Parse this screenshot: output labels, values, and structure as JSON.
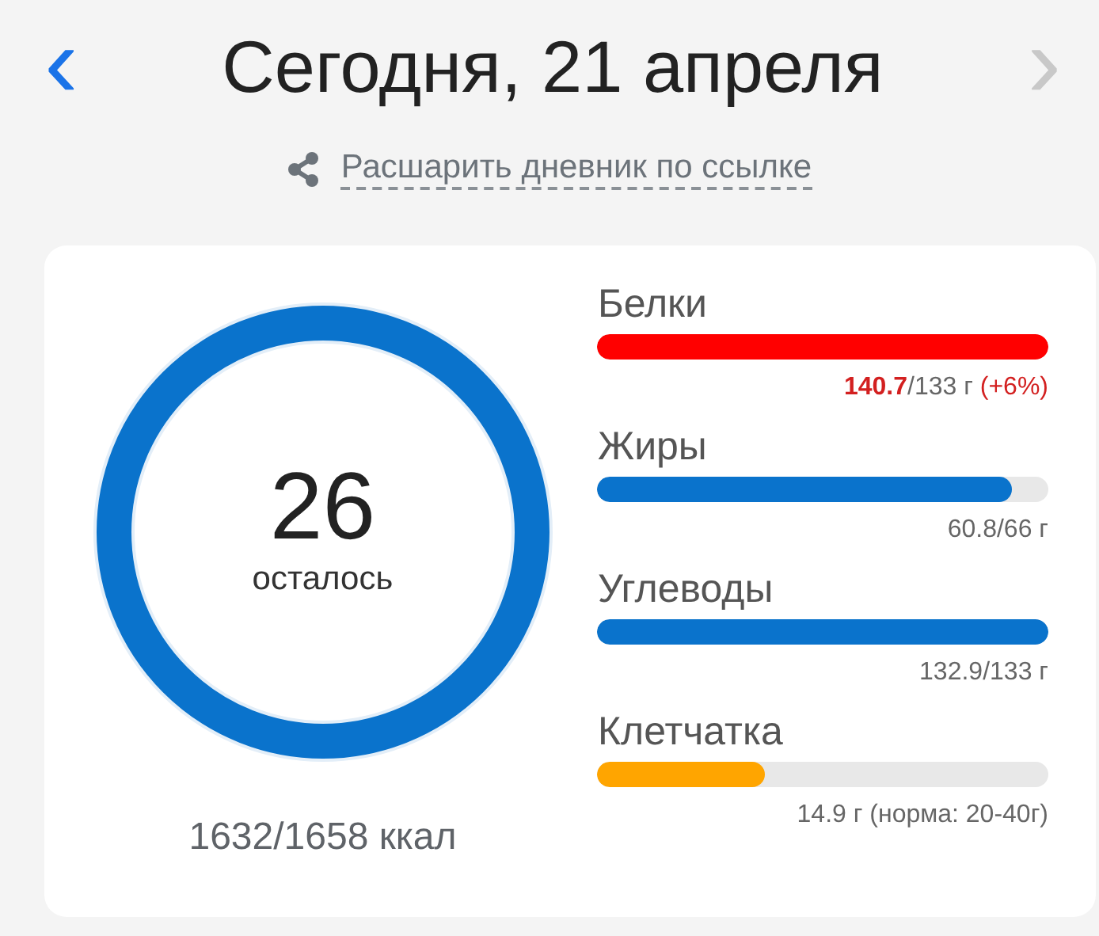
{
  "header": {
    "prev_arrow": "‹",
    "title": "Сегодня, 21 апреля",
    "next_arrow": "›",
    "share_link": "Расшарить дневник по ссылке"
  },
  "calories": {
    "level": 1,
    "remaining": "26",
    "remaining_label": "осталось",
    "total": "1632/1658 ккал"
  },
  "macros": [
    {
      "name": "Белки",
      "level": 1,
      "color": "#ff0000",
      "over": true,
      "value": "140.7",
      "target": "/133 г",
      "note": "(+6%)"
    },
    {
      "name": "Жиры",
      "level": 0.92,
      "color": "#0a73cc",
      "over": false,
      "value": "60.8",
      "target": "/66 г"
    },
    {
      "name": "Углеводы",
      "level": 1,
      "color": "#0a73cc",
      "over": false,
      "value": "132.9",
      "target": "/133 г"
    },
    {
      "name": "Клетчатка",
      "level": 0.37,
      "color": "#ffa500",
      "over": false,
      "value": "14.9 г",
      "note": "(норма: 20-40г)"
    }
  ]
}
